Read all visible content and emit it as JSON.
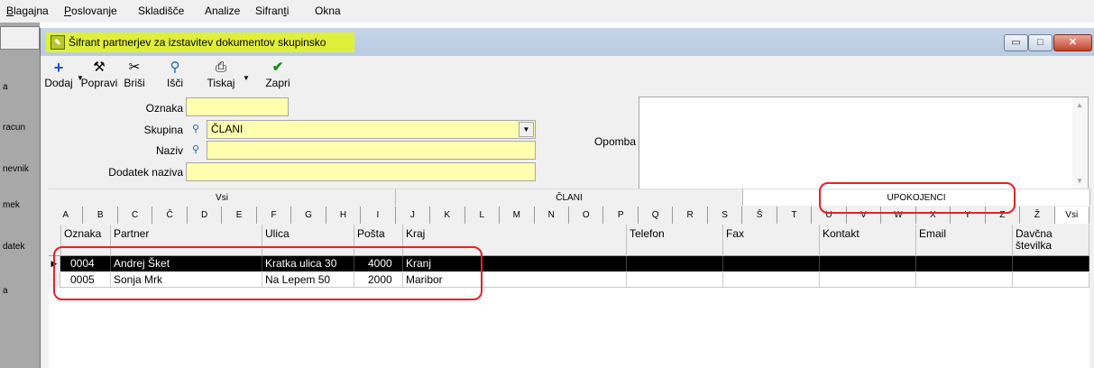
{
  "menu": {
    "items": [
      {
        "first": "B",
        "rest": "lagajna"
      },
      {
        "first": "P",
        "rest": "oslovanje"
      },
      {
        "first": "",
        "rest": "Skladišče"
      },
      {
        "first": "",
        "rest": "Analize"
      },
      {
        "first": "",
        "rest": "Sifran",
        "underline": "t",
        "tail": "i"
      },
      {
        "first": "",
        "rest": "Okna"
      }
    ]
  },
  "left_panel": {
    "labels": [
      "a",
      "racun",
      "nevnik",
      "mek",
      "datek",
      "a"
    ]
  },
  "window": {
    "title": "Šifrant partnerjev za izstavitev dokumentov skupinsko",
    "icon": "window-app-icon",
    "controls": {
      "minimize": "▭",
      "maximize": "□",
      "close": "✕"
    }
  },
  "toolbar": {
    "dodaj": "Dodaj",
    "popravi": "Popravi",
    "brisi": "Briši",
    "isci": "Išči",
    "tiskaj": "Tiskaj",
    "zapri": "Zapri",
    "icons": {
      "dodaj": "plus-icon",
      "popravi": "hammer-icon",
      "brisi": "scissors-icon",
      "isci": "magnifier-icon",
      "tiskaj": "printer-icon",
      "zapri": "checkmark-icon"
    }
  },
  "form": {
    "oznaka_label": "Oznaka",
    "oznaka_value": "",
    "skupina_label": "Skupina",
    "skupina_value": "ČLANI",
    "naziv_label": "Naziv",
    "naziv_value": "",
    "dodatek_label": "Dodatek naziva",
    "dodatek_value": "",
    "opomba_label": "Opomba",
    "opomba_value": ""
  },
  "group_tabs": [
    {
      "label": "Vsi",
      "active": false
    },
    {
      "label": "ČLANI",
      "active": false
    },
    {
      "label": "UPOKOJENCI",
      "active": true
    }
  ],
  "letter_tabs": [
    "A",
    "B",
    "C",
    "Č",
    "D",
    "E",
    "F",
    "G",
    "H",
    "I",
    "J",
    "K",
    "L",
    "M",
    "N",
    "O",
    "P",
    "Q",
    "R",
    "S",
    "Š",
    "T",
    "U",
    "V",
    "W",
    "X",
    "Y",
    "Z",
    "Ž",
    "Vsi"
  ],
  "grid": {
    "columns": [
      "Oznaka",
      "Partner",
      "Ulica",
      "Pošta",
      "Kraj",
      "Telefon",
      "Fax",
      "Kontakt",
      "Email",
      "Davčna številka"
    ],
    "rows": [
      {
        "oznaka": "0004",
        "partner": "Andrej Šket",
        "ulica": "Kratka ulica 30",
        "posta": "4000",
        "kraj": "Kranj",
        "selected": true
      },
      {
        "oznaka": "0005",
        "partner": "Sonja Mrk",
        "ulica": "Na Lepem 50",
        "posta": "2000",
        "kraj": "Maribor",
        "selected": false
      }
    ]
  },
  "colors": {
    "title_highlight": "#dff03a",
    "input_background": "#ffffb0",
    "annotation_red": "#e2222a",
    "selected_row": "#000000"
  }
}
